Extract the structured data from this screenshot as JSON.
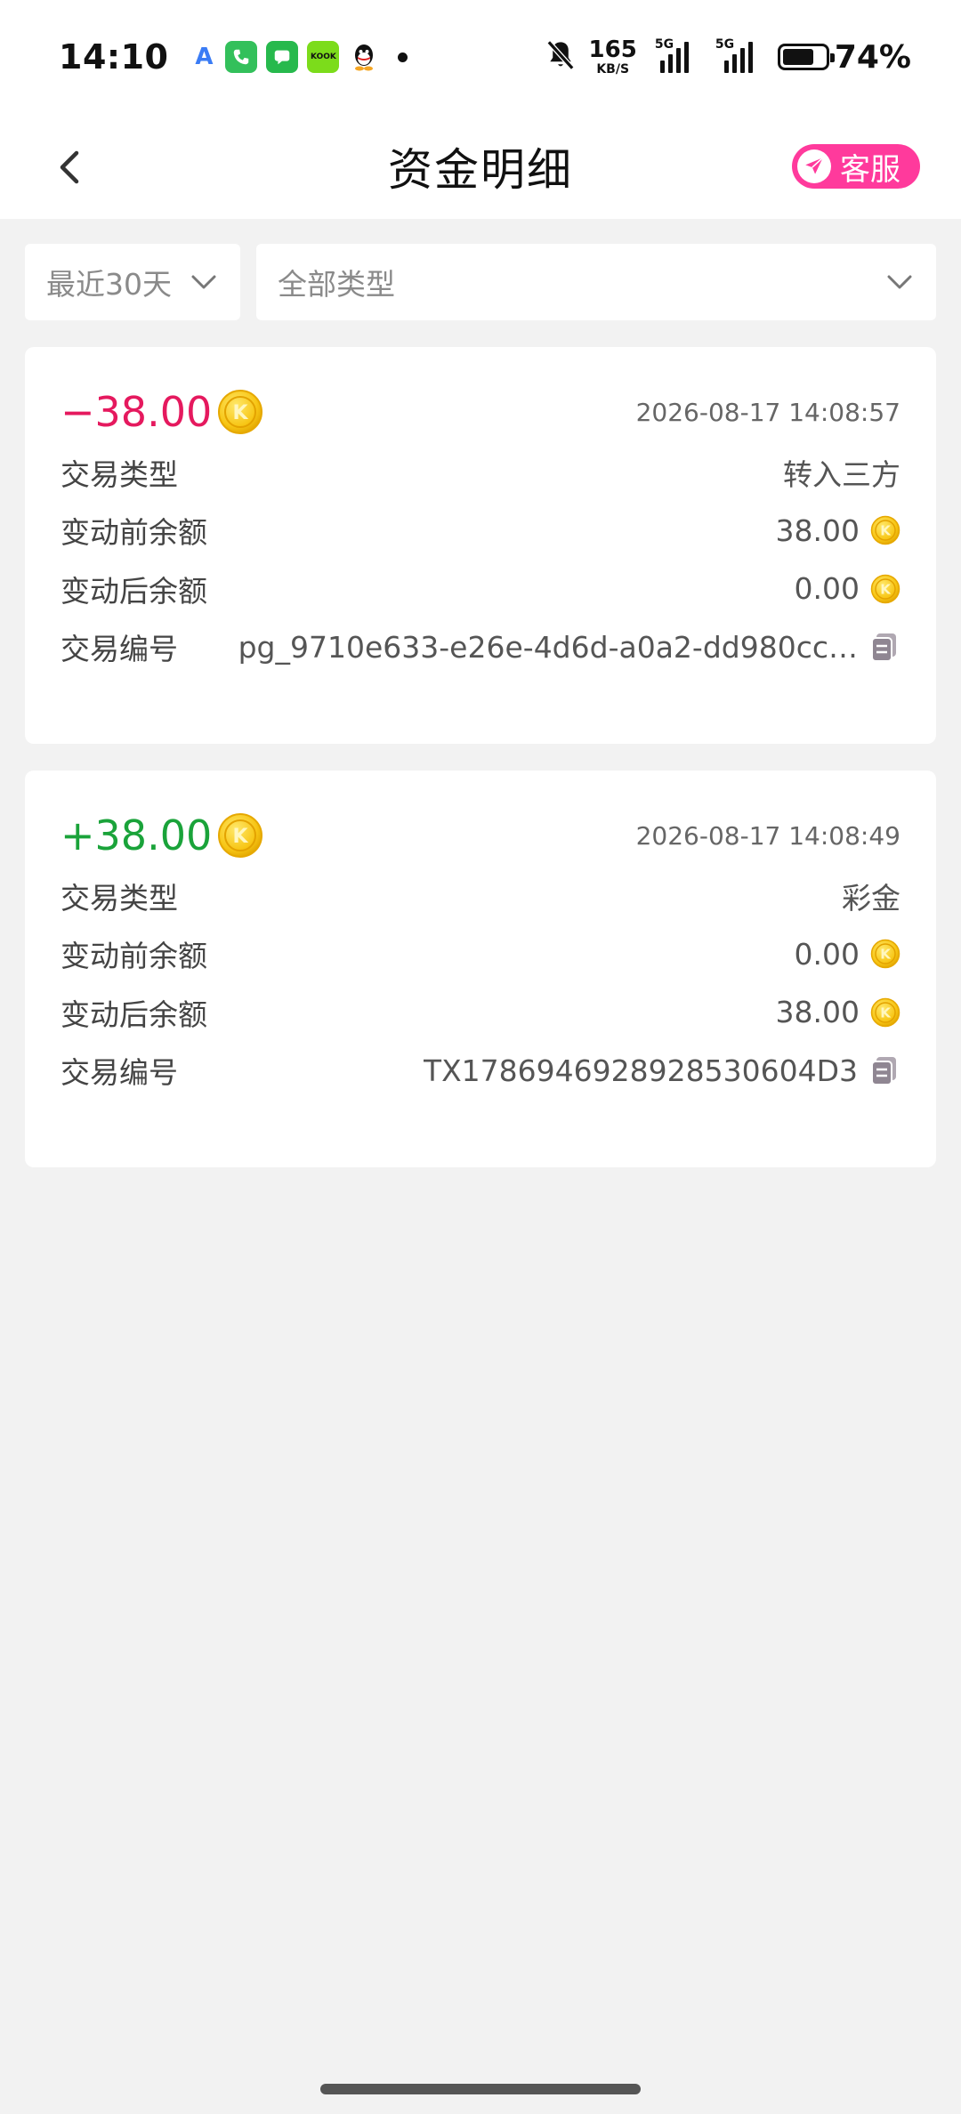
{
  "status_bar": {
    "time": "14:10",
    "net_speed": "165",
    "net_unit": "KB/S",
    "sig1_tag": "5G",
    "sig2_tag": "5G",
    "battery": "74%",
    "battery_level": 0.74
  },
  "header": {
    "title": "资金明细",
    "service_label": "客服"
  },
  "filters": {
    "date_label": "最近30天",
    "type_label": "全部类型"
  },
  "records": [
    {
      "amount": "−38.00",
      "time": "2026-08-17 14:08:57",
      "type_label": "交易类型",
      "type_value": "转入三方",
      "before_label": "变动前余额",
      "before_value": "38.00",
      "after_label": "变动后余额",
      "after_value": "0.00",
      "id_label": "交易编号",
      "id_value": "pg_9710e633-e26e-4d6d-a0a2-dd980cc…"
    },
    {
      "amount": "+38.00",
      "time": "2026-08-17 14:08:49",
      "type_label": "交易类型",
      "type_value": "彩金",
      "before_label": "变动前余额",
      "before_value": "0.00",
      "after_label": "变动后余额",
      "after_value": "38.00",
      "id_label": "交易编号",
      "id_value": "TX1786946928928530604D3"
    }
  ],
  "colors": {
    "negative": "#e5195e",
    "positive": "#1aa33a",
    "service_button": "#ff3a9c",
    "coin": "#f7c514"
  },
  "icons": {
    "back": "chevron-left-icon",
    "service": "paper-plane-icon",
    "dropdown": "chevron-down-icon",
    "coin": "k-coin-icon",
    "copy": "copy-icon"
  }
}
